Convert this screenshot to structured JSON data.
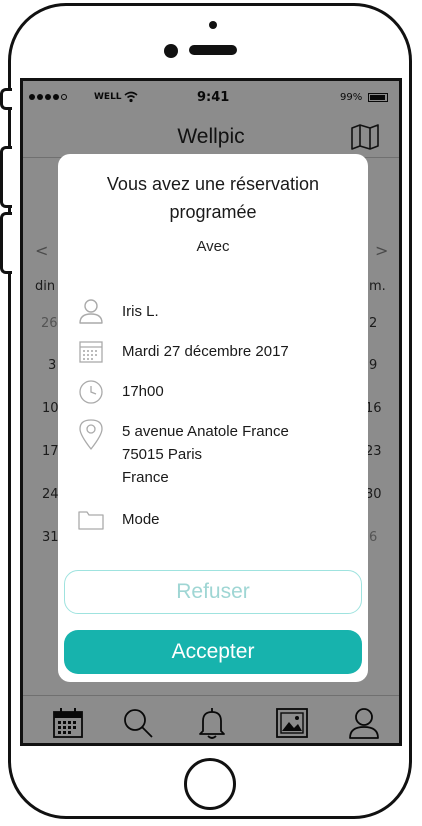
{
  "status_bar": {
    "carrier": "WELL",
    "time": "9:41",
    "battery": "99%"
  },
  "nav": {
    "title": "Wellpic",
    "right_icon": "map-icon"
  },
  "calendar_bg": {
    "prev_arrow": "<",
    "next_arrow": ">",
    "day_left": "din",
    "day_right": "m.",
    "left_numbers": [
      "26",
      "3",
      "10",
      "17",
      "24",
      "31"
    ],
    "right_numbers": [
      "2",
      "9",
      "16",
      "23",
      "30",
      "6"
    ]
  },
  "modal": {
    "title": "Vous avez une réservation programée",
    "subtitle": "Avec",
    "person": "Iris L.",
    "date": "Mardi 27 décembre 2017",
    "time": "17h00",
    "address_line1": "5 avenue Anatole France",
    "address_line2": "75015 Paris",
    "address_line3": "France",
    "category": "Mode",
    "refuse_label": "Refuser",
    "accept_label": "Accepter"
  },
  "tabs": [
    "calendar-icon",
    "search-icon",
    "bell-icon",
    "image-icon",
    "profile-icon"
  ],
  "colors": {
    "accent": "#17b3ad",
    "refuse_border": "#9fe3df",
    "refuse_text": "#9fd6d4",
    "overlay": "rgba(0,0,0,0.45)"
  }
}
